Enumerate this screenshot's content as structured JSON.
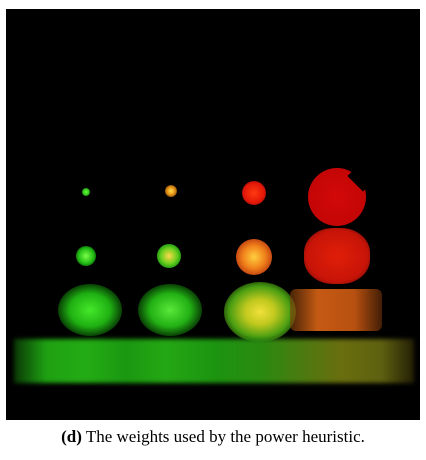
{
  "figure": {
    "caption_label": "(d)",
    "caption_text": " The weights used by the power heuristic."
  },
  "colors": {
    "background": "#000000",
    "green": "#1fb012",
    "yellow": "#ffd84a",
    "orange": "#f0801a",
    "red": "#c40606"
  }
}
